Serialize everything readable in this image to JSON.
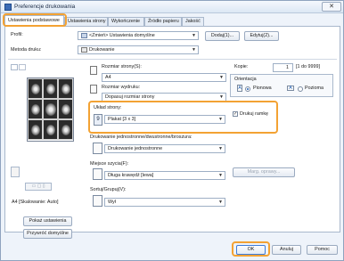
{
  "window": {
    "title": "Preferencje drukowania",
    "close_glyph": "✕"
  },
  "tabs": [
    {
      "label": "Ustawienia podstawowe"
    },
    {
      "label": "Ustawienia strony"
    },
    {
      "label": "Wykończenie"
    },
    {
      "label": "Źródło papieru"
    },
    {
      "label": "Jakość"
    }
  ],
  "profile": {
    "label": "Profil:",
    "value": "<Zmień> Ustawienia domyślne",
    "add_button": "Dodaj(1)...",
    "edit_button": "Edytuj(2)..."
  },
  "output_method": {
    "label": "Metoda druku:",
    "value": "Drukowanie"
  },
  "page_size": {
    "label": "Rozmiar strony(S):",
    "value": "A4"
  },
  "output_size": {
    "label": "Rozmiar wydruku:",
    "value": "Dopasuj rozmiar strony"
  },
  "copies": {
    "label": "Kopie:",
    "value": "1",
    "range": "[1 do 9999]"
  },
  "orientation": {
    "label": "Orientacja",
    "portrait": "Pionowa",
    "landscape": "Pozioma",
    "selected": "portrait"
  },
  "layout": {
    "label": "Układ strony:",
    "value": "Plakat [3 x 3]",
    "number": "9",
    "print_border_label": "Drukuj ramkę",
    "print_border_checked": true
  },
  "duplex": {
    "label": "Drukowanie jednostronne/dwustronne/broszura:",
    "value": "Drukowanie jednostronne"
  },
  "binding": {
    "label": "Miejsce szycia(F):",
    "value": "Długa krawędź [lewa]",
    "margin_button": "Marg. oprawy..."
  },
  "collate": {
    "label": "Sortuj/Grupuj(V):",
    "value": "Wył"
  },
  "preview": {
    "caption": "A4 [Skalowanie: Auto]",
    "view_settings_button": "Pokaż ustawienia",
    "restore_defaults_button": "Przywróć domyślne"
  },
  "footer": {
    "ok": "OK",
    "cancel": "Anuluj",
    "help": "Pomoc"
  },
  "colors": {
    "highlight": "#f3a233",
    "panel_bg": "#eef3fa",
    "accent": "#1f5fb4"
  }
}
